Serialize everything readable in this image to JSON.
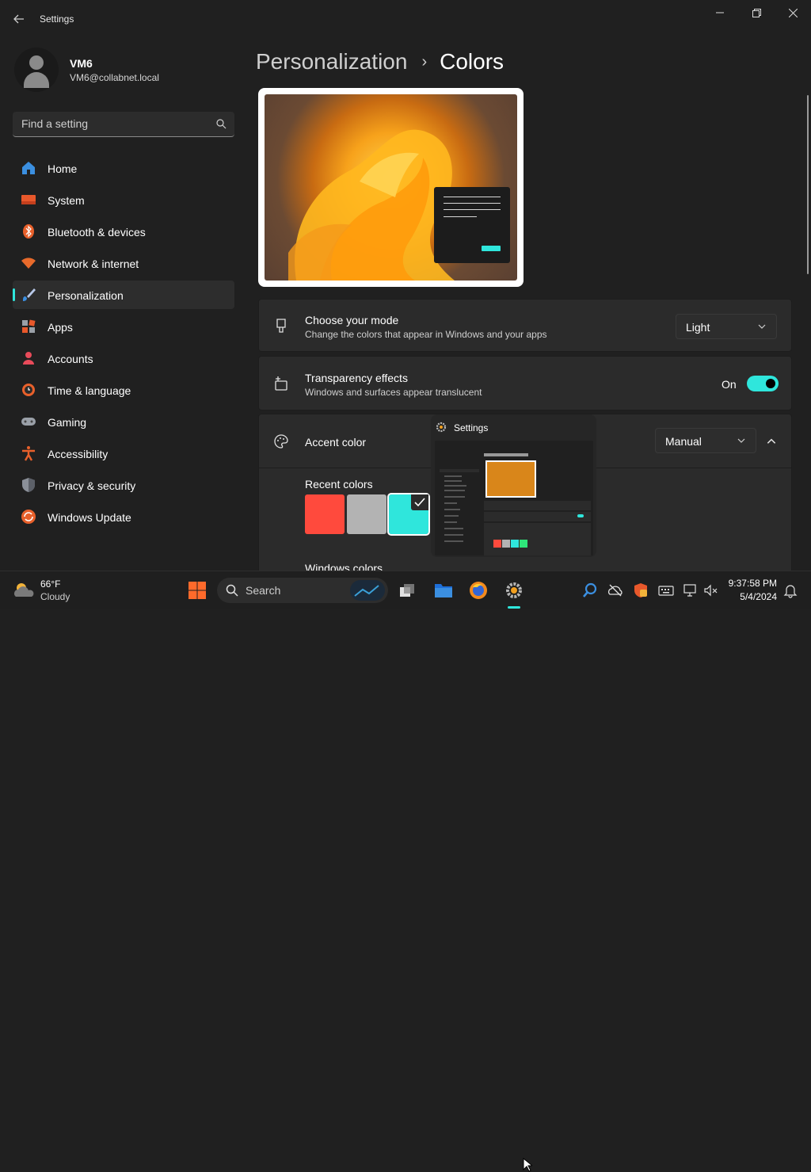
{
  "window": {
    "title": "Settings",
    "back_icon": "back-arrow-icon",
    "controls": [
      "minimize-icon",
      "restore-icon",
      "close-icon"
    ]
  },
  "profile": {
    "name": "VM6",
    "email": "VM6@collabnet.local"
  },
  "search": {
    "placeholder": "Find a setting"
  },
  "sidebar": {
    "items": [
      {
        "label": "Home",
        "icon": "home-icon",
        "active": false
      },
      {
        "label": "System",
        "icon": "system-icon",
        "active": false
      },
      {
        "label": "Bluetooth & devices",
        "icon": "bluetooth-icon",
        "active": false
      },
      {
        "label": "Network & internet",
        "icon": "wifi-icon",
        "active": false
      },
      {
        "label": "Personalization",
        "icon": "brush-icon",
        "active": true
      },
      {
        "label": "Apps",
        "icon": "apps-icon",
        "active": false
      },
      {
        "label": "Accounts",
        "icon": "accounts-icon",
        "active": false
      },
      {
        "label": "Time & language",
        "icon": "time-language-icon",
        "active": false
      },
      {
        "label": "Gaming",
        "icon": "gamepad-icon",
        "active": false
      },
      {
        "label": "Accessibility",
        "icon": "accessibility-icon",
        "active": false
      },
      {
        "label": "Privacy & security",
        "icon": "shield-icon",
        "active": false
      },
      {
        "label": "Windows Update",
        "icon": "update-icon",
        "active": false
      }
    ]
  },
  "breadcrumb": {
    "parent": "Personalization",
    "separator": "›",
    "current": "Colors"
  },
  "mode_card": {
    "title": "Choose your mode",
    "subtitle": "Change the colors that appear in Windows and your apps",
    "value": "Light"
  },
  "transparency_card": {
    "title": "Transparency effects",
    "subtitle": "Windows and surfaces appear translucent",
    "state": "On"
  },
  "accent_card": {
    "title": "Accent color",
    "value": "Manual",
    "recent_label": "Recent colors",
    "recent_colors": [
      "#ff4a3d",
      "#b3b3b3",
      "#2fe6dc"
    ],
    "selected_index": 2,
    "windows_colors_label": "Windows colors"
  },
  "thumbnail": {
    "title": "Settings"
  },
  "taskbar": {
    "weather": {
      "temp": "66°F",
      "condition": "Cloudy"
    },
    "search_label": "Search",
    "clock": {
      "time": "9:37:58 PM",
      "date": "5/4/2024"
    }
  },
  "colors": {
    "accent": "#2fe6dc",
    "background": "#202020",
    "card": "#2b2b2b"
  }
}
